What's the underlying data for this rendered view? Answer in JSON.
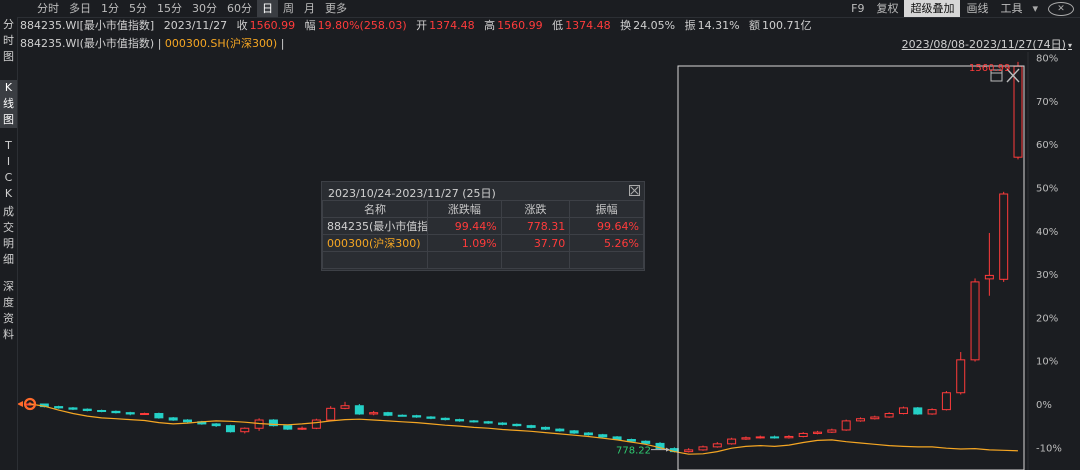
{
  "toolbar": {
    "periods": [
      {
        "label": "分时",
        "active": false
      },
      {
        "label": "多日",
        "active": false
      },
      {
        "label": "1分",
        "active": false
      },
      {
        "label": "5分",
        "active": false
      },
      {
        "label": "15分",
        "active": false
      },
      {
        "label": "30分",
        "active": false
      },
      {
        "label": "60分",
        "active": false
      },
      {
        "label": "日",
        "active": true
      },
      {
        "label": "周",
        "active": false
      },
      {
        "label": "月",
        "active": false
      },
      {
        "label": "更多",
        "active": false
      }
    ],
    "right": {
      "f9": "F9",
      "fuquan": "复权",
      "overlay": "超级叠加",
      "draw": "画线",
      "tools": "工具",
      "tools_arrow": "▾",
      "close_symbol": "✕"
    }
  },
  "quote": {
    "code": "884235.WI[最小市值指数]",
    "date": "2023/11/27",
    "close_label": "收",
    "close": "1560.99",
    "change_label": "幅",
    "change": "19.80%(258.03)",
    "open_label": "开",
    "open": "1374.48",
    "high_label": "高",
    "high": "1560.99",
    "low_label": "低",
    "low": "1374.48",
    "turnover_label": "换",
    "turnover": "24.05%",
    "amplitude_label": "振",
    "amplitude": "14.31%",
    "amount_label": "额",
    "amount": "100.71亿"
  },
  "legend": {
    "main": "884235.WI(最小市值指数)",
    "sep": " | ",
    "overlay": "000300.SH(沪深300)",
    "sep2": " |",
    "range": "2023/08/08-2023/11/27(74日)",
    "range_arrow": "▾"
  },
  "left_tabs": [
    {
      "label": "分时图",
      "active": false
    },
    {
      "label": "K线图",
      "active": true
    },
    {
      "label": "TICK",
      "active": false
    },
    {
      "label": "成交明细",
      "active": false
    },
    {
      "label": "深度资料",
      "active": false
    }
  ],
  "popup": {
    "title": "2023/10/24-2023/11/27 (25日)",
    "headers": [
      "名称",
      "涨跌幅",
      "涨跌",
      "振幅"
    ],
    "rows": [
      {
        "name": "884235(最小市值指数)",
        "pct": "99.44%",
        "chg": "778.31",
        "amp": "99.64%"
      },
      {
        "name": "000300(沪深300)",
        "pct": "1.09%",
        "chg": "37.70",
        "amp": "5.26%"
      }
    ]
  },
  "chart_data": {
    "type": "candlestick",
    "y_axis_ticks": [
      "80%",
      "70%",
      "60%",
      "50%",
      "40%",
      "30%",
      "20%",
      "10%",
      "0%",
      "-10%"
    ],
    "ylim": [
      -12,
      81
    ],
    "annotations": {
      "high": "1560.99",
      "low": "778.22"
    },
    "colors": {
      "up": "#ff3b3b",
      "down": "#25d0c6",
      "overlay": "#f5a623",
      "grid": "#2a2d32",
      "selection": "#d8d8d8"
    },
    "candles": [
      {
        "o": 0,
        "c": 0,
        "h": 0.3,
        "l": -0.3
      },
      {
        "o": 0,
        "c": -0.6,
        "h": 0.1,
        "l": -0.8
      },
      {
        "o": -0.6,
        "c": -0.9,
        "h": -0.4,
        "l": -1.1
      },
      {
        "o": -0.9,
        "c": -1.2,
        "h": -0.7,
        "l": -1.4
      },
      {
        "o": -1.2,
        "c": -1.5,
        "h": -1.0,
        "l": -1.7
      },
      {
        "o": -1.5,
        "c": -1.7,
        "h": -1.3,
        "l": -1.9
      },
      {
        "o": -1.7,
        "c": -2.0,
        "h": -1.5,
        "l": -2.2
      },
      {
        "o": -2.0,
        "c": -2.3,
        "h": -1.8,
        "l": -2.6
      },
      {
        "o": -2.3,
        "c": -2.2,
        "h": -2.0,
        "l": -2.5
      },
      {
        "o": -2.2,
        "c": -3.2,
        "h": -2.0,
        "l": -3.4
      },
      {
        "o": -3.2,
        "c": -3.7,
        "h": -3.0,
        "l": -3.9
      },
      {
        "o": -3.7,
        "c": -4.1,
        "h": -3.5,
        "l": -4.3
      },
      {
        "o": -4.1,
        "c": -4.6,
        "h": -3.9,
        "l": -4.8
      },
      {
        "o": -4.6,
        "c": -5.0,
        "h": -4.4,
        "l": -5.3
      },
      {
        "o": -5.0,
        "c": -6.4,
        "h": -4.8,
        "l": -6.6
      },
      {
        "o": -6.4,
        "c": -5.6,
        "h": -5.4,
        "l": -6.8
      },
      {
        "o": -5.6,
        "c": -3.7,
        "h": -3.3,
        "l": -6.2
      },
      {
        "o": -3.7,
        "c": -5.0,
        "h": -3.5,
        "l": -5.2
      },
      {
        "o": -5.0,
        "c": -5.8,
        "h": -4.8,
        "l": -6.0
      },
      {
        "o": -5.8,
        "c": -5.6,
        "h": -5.2,
        "l": -6.0
      },
      {
        "o": -5.6,
        "c": -3.7,
        "h": -3.4,
        "l": -5.8
      },
      {
        "o": -3.7,
        "c": -1.0,
        "h": -0.5,
        "l": -4.0
      },
      {
        "o": -1.0,
        "c": -0.4,
        "h": 0.5,
        "l": -1.2
      },
      {
        "o": -0.4,
        "c": -2.3,
        "h": 0.0,
        "l": -2.5
      },
      {
        "o": -2.3,
        "c": -2.0,
        "h": -1.6,
        "l": -2.6
      },
      {
        "o": -2.0,
        "c": -2.6,
        "h": -1.8,
        "l": -2.8
      },
      {
        "o": -2.6,
        "c": -2.7,
        "h": -2.4,
        "l": -2.9
      },
      {
        "o": -2.7,
        "c": -3.0,
        "h": -2.5,
        "l": -3.2
      },
      {
        "o": -3.0,
        "c": -3.3,
        "h": -2.8,
        "l": -3.5
      },
      {
        "o": -3.3,
        "c": -3.6,
        "h": -3.1,
        "l": -3.8
      },
      {
        "o": -3.6,
        "c": -3.9,
        "h": -3.4,
        "l": -4.1
      },
      {
        "o": -3.9,
        "c": -4.1,
        "h": -3.7,
        "l": -4.3
      },
      {
        "o": -4.1,
        "c": -4.4,
        "h": -3.9,
        "l": -4.6
      },
      {
        "o": -4.4,
        "c": -4.7,
        "h": -4.2,
        "l": -4.9
      },
      {
        "o": -4.7,
        "c": -5.0,
        "h": -4.5,
        "l": -5.2
      },
      {
        "o": -5.0,
        "c": -5.4,
        "h": -4.8,
        "l": -5.6
      },
      {
        "o": -5.4,
        "c": -5.8,
        "h": -5.2,
        "l": -6.0
      },
      {
        "o": -5.8,
        "c": -6.2,
        "h": -5.6,
        "l": -6.4
      },
      {
        "o": -6.2,
        "c": -6.7,
        "h": -6.0,
        "l": -6.9
      },
      {
        "o": -6.7,
        "c": -7.1,
        "h": -6.5,
        "l": -7.3
      },
      {
        "o": -7.1,
        "c": -7.6,
        "h": -6.9,
        "l": -7.8
      },
      {
        "o": -7.6,
        "c": -8.2,
        "h": -7.4,
        "l": -8.4
      },
      {
        "o": -8.2,
        "c": -8.6,
        "h": -8.0,
        "l": -8.8
      },
      {
        "o": -8.6,
        "c": -9.1,
        "h": -8.4,
        "l": -9.3
      },
      {
        "o": -9.1,
        "c": -10.3,
        "h": -8.8,
        "l": -10.6
      },
      {
        "o": -10.3,
        "c": -11.0,
        "h": -10.0,
        "l": -11.2
      },
      {
        "o": -11.0,
        "c": -10.6,
        "h": -10.2,
        "l": -11.2
      },
      {
        "o": -10.6,
        "c": -9.9,
        "h": -9.6,
        "l": -10.8
      },
      {
        "o": -9.9,
        "c": -9.2,
        "h": -8.8,
        "l": -10.1
      },
      {
        "o": -9.2,
        "c": -8.1,
        "h": -7.8,
        "l": -9.4
      },
      {
        "o": -8.1,
        "c": -7.8,
        "h": -7.5,
        "l": -8.3
      },
      {
        "o": -7.8,
        "c": -7.6,
        "h": -7.3,
        "l": -8.0
      },
      {
        "o": -7.6,
        "c": -7.8,
        "h": -7.3,
        "l": -8.0
      },
      {
        "o": -7.8,
        "c": -7.5,
        "h": -7.2,
        "l": -8.0
      },
      {
        "o": -7.5,
        "c": -6.8,
        "h": -6.5,
        "l": -7.7
      },
      {
        "o": -6.8,
        "c": -6.5,
        "h": -6.2,
        "l": -7.0
      },
      {
        "o": -6.5,
        "c": -6.0,
        "h": -5.7,
        "l": -6.7
      },
      {
        "o": -6.0,
        "c": -3.9,
        "h": -3.6,
        "l": -6.2
      },
      {
        "o": -3.9,
        "c": -3.4,
        "h": -3.1,
        "l": -4.1
      },
      {
        "o": -3.4,
        "c": -3.0,
        "h": -2.7,
        "l": -3.6
      },
      {
        "o": -3.0,
        "c": -2.2,
        "h": -1.9,
        "l": -3.2
      },
      {
        "o": -2.2,
        "c": -0.9,
        "h": -0.6,
        "l": -2.4
      },
      {
        "o": -0.9,
        "c": -2.3,
        "h": -0.7,
        "l": -2.5
      },
      {
        "o": -2.3,
        "c": -1.3,
        "h": -1.0,
        "l": -2.5
      },
      {
        "o": -1.3,
        "c": 2.6,
        "h": 3.0,
        "l": -1.5
      },
      {
        "o": 2.6,
        "c": 10.2,
        "h": 12.0,
        "l": 2.2
      },
      {
        "o": 10.2,
        "c": 28.2,
        "h": 29.0,
        "l": 9.8
      },
      {
        "o": 28.9,
        "c": 29.7,
        "h": 39.5,
        "l": 25.0
      },
      {
        "o": 28.8,
        "c": 48.5,
        "h": 49.0,
        "l": 28.2
      },
      {
        "o": 57.0,
        "c": 78.0,
        "h": 79.0,
        "l": 56.5
      }
    ],
    "overlay_line": [
      0,
      -0.5,
      -1.4,
      -2.2,
      -2.8,
      -3.2,
      -3.4,
      -3.6,
      -3.8,
      -4.3,
      -4.6,
      -4.4,
      -4.1,
      -3.9,
      -4.0,
      -4.2,
      -4.5,
      -4.7,
      -4.8,
      -4.6,
      -4.3,
      -3.9,
      -3.6,
      -3.5,
      -3.7,
      -3.9,
      -4.1,
      -4.3,
      -4.6,
      -4.9,
      -5.1,
      -5.4,
      -5.6,
      -5.9,
      -6.1,
      -6.3,
      -6.6,
      -6.9,
      -7.2,
      -7.5,
      -7.9,
      -8.3,
      -8.8,
      -9.3,
      -10.1,
      -11.0,
      -11.6,
      -11.5,
      -11.0,
      -10.2,
      -9.8,
      -9.6,
      -9.8,
      -9.5,
      -8.9,
      -8.4,
      -8.3,
      -8.7,
      -9.0,
      -9.3,
      -9.6,
      -9.8,
      -9.9,
      -9.9,
      -10.2,
      -10.4,
      -10.3,
      -10.6,
      -10.7,
      -10.8
    ]
  }
}
